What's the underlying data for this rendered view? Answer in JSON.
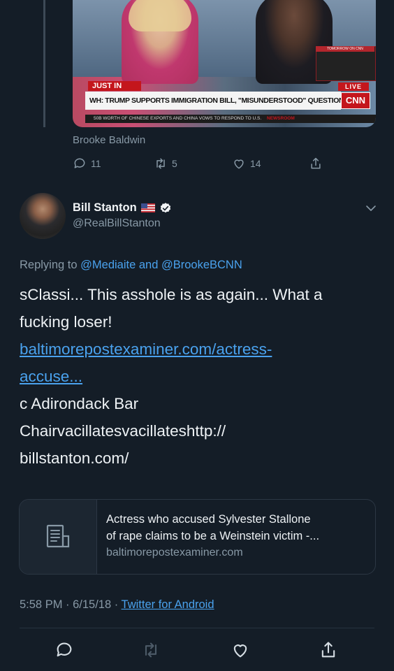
{
  "embedded_media": {
    "badge": "JUST IN",
    "live": "LIVE",
    "network": "CNN",
    "headline": "WH: TRUMP SUPPORTS IMMIGRATION BILL, \"MISUNDERSTOOD\" QUESTION",
    "ticker": "50B WORTH OF CHINESE EXPORTS AND CHINA VOWS TO RESPOND TO U.S.",
    "ticker_label": "NEWSROOM",
    "promo_label": "TOMORROW ON CNN"
  },
  "quoted_caption": "Brooke Baldwin",
  "quoted_stats": {
    "replies": "11",
    "retweets": "5",
    "likes": "14"
  },
  "tweet": {
    "author_name": "Bill Stanton",
    "author_handle": "@RealBillStanton",
    "reply_prefix": "Replying to",
    "reply_to": "@Mediaite and @BrookeBCNN",
    "lines": [
      "sClassi... This asshole is as again... What a",
      "fucking loser!"
    ],
    "link_lines": [
      "baltimorepostexaminer.com/actress-",
      "accuse..."
    ],
    "lines_after": [
      "c Adirondack Bar",
      "Chairvacillatesvacillateshttp://",
      "billstanton.com/"
    ],
    "card": {
      "title_lines": [
        "Actress who accused Sylvester Stallone",
        "of rape claims to be a Weinstein victim -..."
      ],
      "url": "baltimorepostexaminer.com"
    },
    "time": "5:58 PM · 6/15/18 ·",
    "source": "Twitter for Android"
  },
  "icons": {
    "reply": "speech-bubble-icon",
    "retweet": "retweet-icon",
    "like": "heart-icon",
    "share": "share-icon",
    "verified": "verified-badge-icon",
    "flag": "us-flag-icon",
    "menu": "chevron-down-icon",
    "card": "article-icon"
  },
  "colors": {
    "background": "#141d27",
    "link": "#4aa2ee",
    "secondary_text": "#8899a6",
    "cnn_red": "#c4161c"
  }
}
